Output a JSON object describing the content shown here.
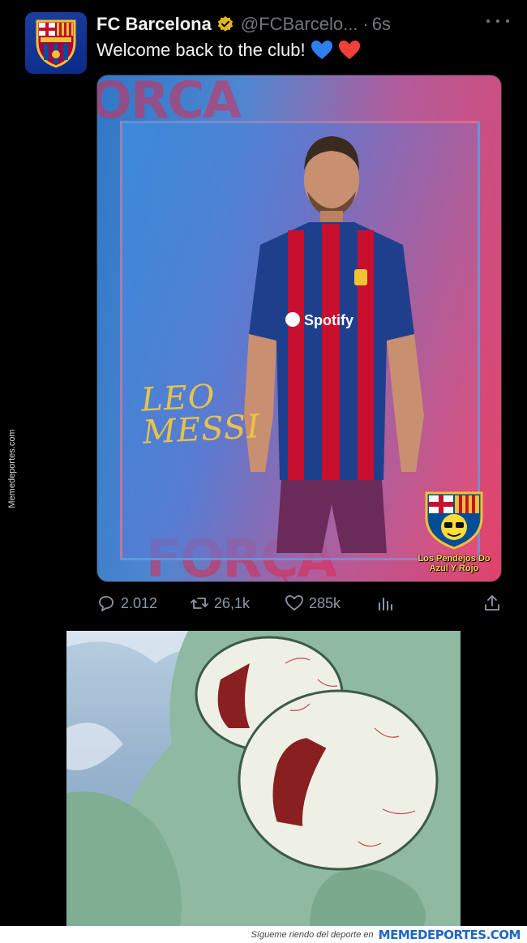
{
  "tweet": {
    "display_name": "FC Barcelona",
    "handle": "@FCBarcelo...",
    "separator": "·",
    "time": "6s",
    "text": "Welcome back to the club!",
    "emojis": [
      "blue-heart",
      "red-heart"
    ],
    "verified_color": "#e2b719",
    "avatar_icon": "fc-barcelona-crest-icon"
  },
  "media": {
    "poster_text": "LEO\nMESSI",
    "sponsor": "Spotify",
    "watermark_text": "Los Pendejos Do Azul Y Rojo",
    "background_colors": [
      "#2f78c6",
      "#e2436b"
    ]
  },
  "actions": {
    "replies": "2.012",
    "retweets": "26,1k",
    "likes": "285k"
  },
  "side_watermark": "Memedeportes.com",
  "footer": {
    "text": "Sígueme riendo del deporte en",
    "brand": "MEMEDEPORTES.COM"
  }
}
